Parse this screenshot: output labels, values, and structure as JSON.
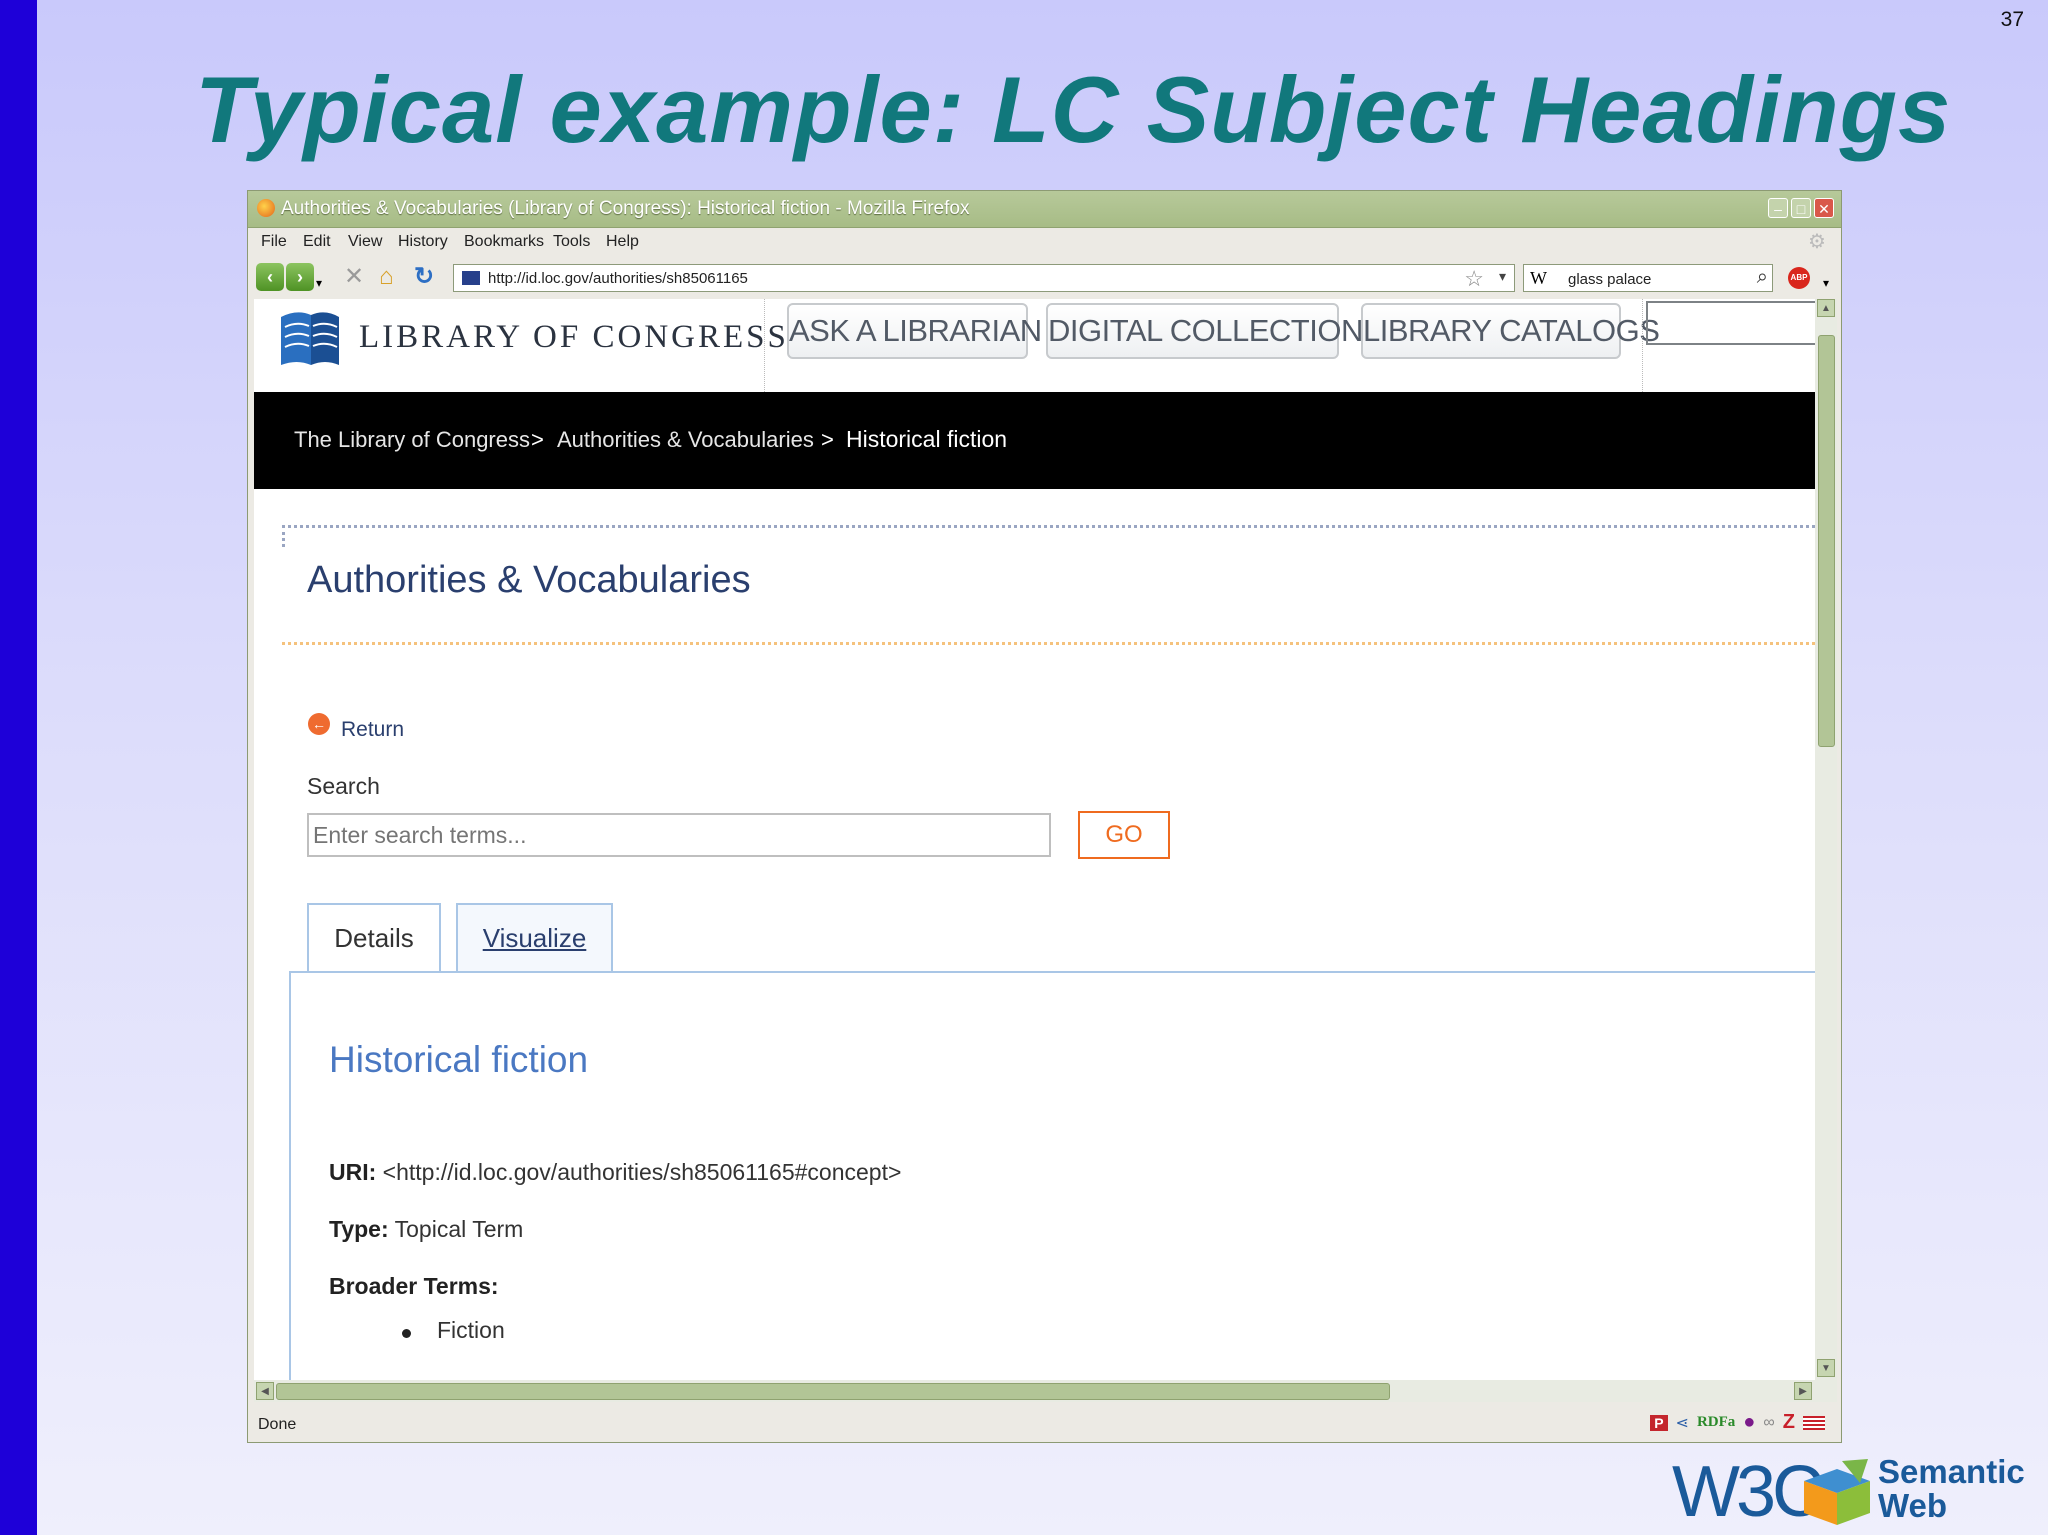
{
  "slide": {
    "number": "37",
    "title": "Typical example: LC Subject Headings"
  },
  "browser": {
    "window_title": "Authorities & Vocabularies (Library of Congress): Historical fiction - Mozilla Firefox",
    "menu": [
      "File",
      "Edit",
      "View",
      "History",
      "Bookmarks",
      "Tools",
      "Help"
    ],
    "url": "http://id.loc.gov/authorities/sh85061165",
    "search_engine_glyph": "W",
    "search_value": "glass palace",
    "status": "Done",
    "status_icons": [
      "P",
      "share",
      "RDFa",
      "dot",
      "link",
      "Z",
      "flag"
    ]
  },
  "page": {
    "site_name": "LIBRARY OF CONGRESS",
    "nav_buttons": [
      "ASK A LIBRARIAN",
      "DIGITAL COLLECTIONS",
      "LIBRARY CATALOGS"
    ],
    "breadcrumbs": [
      "The Library of Congress",
      "Authorities & Vocabularies",
      "Historical fiction"
    ],
    "breadcrumb_sep": ">",
    "section_title": "Authorities & Vocabularies",
    "return_label": "Return",
    "search_label": "Search",
    "search_placeholder": "Enter search terms...",
    "go_label": "GO",
    "tabs": [
      "Details",
      "Visualize"
    ],
    "heading": "Historical fiction",
    "uri_label": "URI:",
    "uri_value": "<http://id.loc.gov/authorities/sh85061165#concept>",
    "type_label": "Type:",
    "type_value": "Topical Term",
    "broader_label": "Broader Terms:",
    "broader_terms": [
      "Fiction"
    ]
  },
  "logo": {
    "w3c": "W3C",
    "line1": "Semantic",
    "line2": "Web"
  },
  "colors": {
    "title": "#11787c",
    "sidebar": "#1e00d8",
    "go_accent": "#ef6b1f",
    "link": "#2a3f6e",
    "heading": "#4a78c2"
  }
}
